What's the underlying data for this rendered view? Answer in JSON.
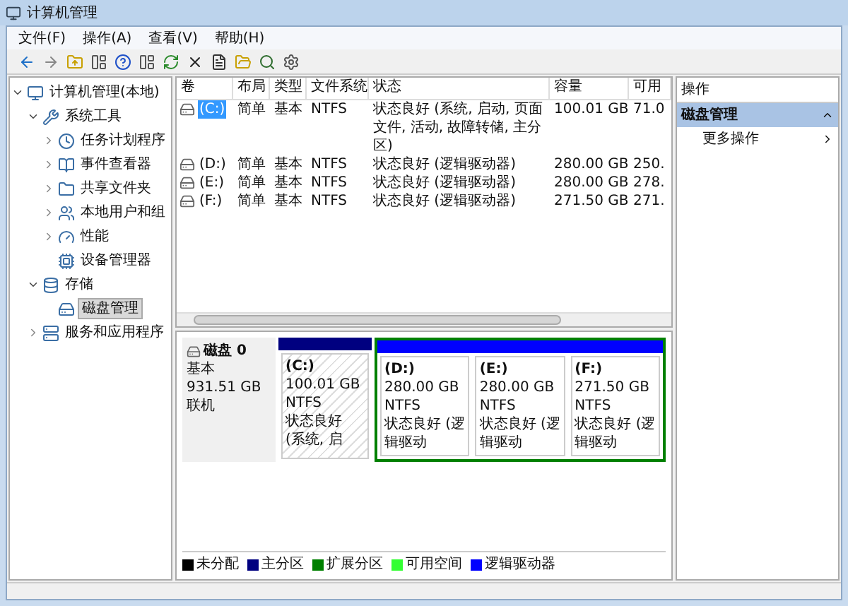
{
  "window": {
    "title": "计算机管理"
  },
  "menu": [
    "文件(F)",
    "操作(A)",
    "查看(V)",
    "帮助(H)"
  ],
  "tree": [
    {
      "label": "计算机管理(本地)",
      "kind": "computer",
      "expanded": true,
      "selected": false,
      "children": [
        {
          "label": "系统工具",
          "kind": "tools",
          "expanded": true,
          "selected": false,
          "children": [
            {
              "label": "任务计划程序",
              "kind": "clock",
              "expanded": false,
              "selected": false
            },
            {
              "label": "事件查看器",
              "kind": "event",
              "expanded": false,
              "selected": false
            },
            {
              "label": "共享文件夹",
              "kind": "folder",
              "expanded": false,
              "selected": false
            },
            {
              "label": "本地用户和组",
              "kind": "users",
              "expanded": false,
              "selected": false
            },
            {
              "label": "性能",
              "kind": "perf",
              "expanded": false,
              "selected": false
            },
            {
              "label": "设备管理器",
              "kind": "device",
              "selected": false
            }
          ]
        },
        {
          "label": "存储",
          "kind": "storage",
          "expanded": true,
          "selected": false,
          "children": [
            {
              "label": "磁盘管理",
              "kind": "disk",
              "selected": true
            }
          ]
        },
        {
          "label": "服务和应用程序",
          "kind": "services",
          "expanded": false,
          "selected": false
        }
      ]
    }
  ],
  "table": {
    "columns": [
      "卷",
      "布局",
      "类型",
      "文件系统",
      "状态",
      "容量",
      "可用"
    ],
    "rows": [
      {
        "volume": "(C:)",
        "selected": true,
        "layout": "简单",
        "type": "基本",
        "fs": "NTFS",
        "status": "状态良好 (系统, 启动, 页面文件, 活动, 故障转储, 主分区)",
        "capacity": "100.01 GB",
        "free": "71.0"
      },
      {
        "volume": "(D:)",
        "selected": false,
        "layout": "简单",
        "type": "基本",
        "fs": "NTFS",
        "status": "状态良好 (逻辑驱动器)",
        "capacity": "280.00 GB",
        "free": "250."
      },
      {
        "volume": "(E:)",
        "selected": false,
        "layout": "简单",
        "type": "基本",
        "fs": "NTFS",
        "status": "状态良好 (逻辑驱动器)",
        "capacity": "280.00 GB",
        "free": "278."
      },
      {
        "volume": "(F:)",
        "selected": false,
        "layout": "简单",
        "type": "基本",
        "fs": "NTFS",
        "status": "状态良好 (逻辑驱动器)",
        "capacity": "271.50 GB",
        "free": "271."
      }
    ]
  },
  "disk": {
    "name": "磁盘 0",
    "type": "基本",
    "size": "931.51 GB",
    "status": "联机",
    "partitions": [
      {
        "kind": "primary",
        "label": "(C:)",
        "size": "100.01 GB NTFS",
        "status": "状态良好 (系统, 启"
      },
      {
        "kind": "logical",
        "label": "(D:)",
        "size": "280.00 GB NTFS",
        "status": "状态良好 (逻辑驱动"
      },
      {
        "kind": "logical",
        "label": "(E:)",
        "size": "280.00 GB NTFS",
        "status": "状态良好 (逻辑驱动"
      },
      {
        "kind": "logical",
        "label": "(F:)",
        "size": "271.50 GB NTFS",
        "status": "状态良好 (逻辑驱动"
      }
    ]
  },
  "legend": [
    {
      "label": "未分配",
      "color": "#000000"
    },
    {
      "label": "主分区",
      "color": "#000080"
    },
    {
      "label": "扩展分区",
      "color": "#008000"
    },
    {
      "label": "可用空间",
      "color": "#33ff33"
    },
    {
      "label": "逻辑驱动器",
      "color": "#0000ff"
    }
  ],
  "actions": {
    "header": "操作",
    "section": "磁盘管理",
    "expanded": true,
    "items": [
      "更多操作"
    ]
  }
}
